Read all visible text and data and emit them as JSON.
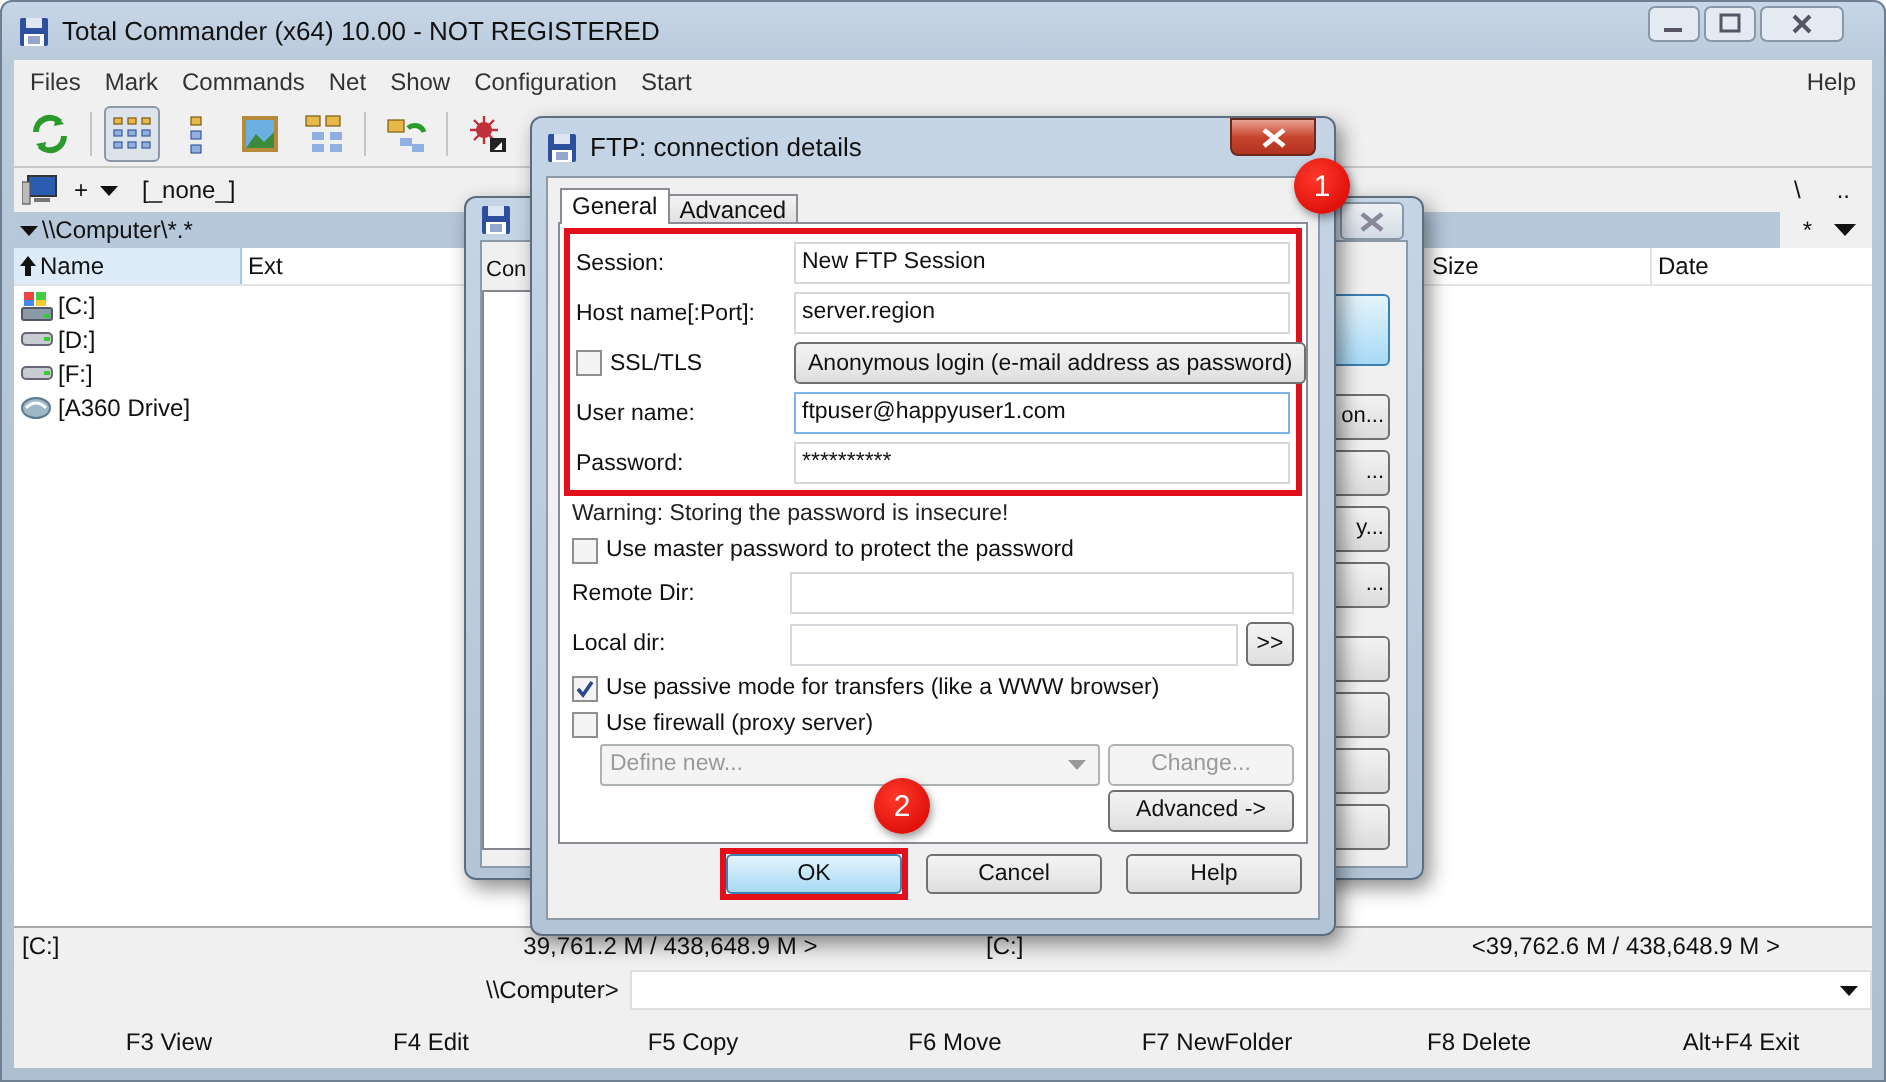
{
  "window": {
    "title": "Total Commander (x64) 10.00 - NOT REGISTERED"
  },
  "menu": [
    "Files",
    "Mark",
    "Commands",
    "Net",
    "Show",
    "Configuration",
    "Start"
  ],
  "menu_right": "Help",
  "toolbar": [
    {
      "kind": "refresh",
      "selected": false
    },
    {
      "kind": "brief",
      "selected": true
    },
    {
      "kind": "detail",
      "selected": false
    },
    {
      "kind": "thumbs",
      "selected": false
    },
    {
      "kind": "tree",
      "selected": false
    },
    {
      "kind": "sync",
      "selected": false
    },
    {
      "kind": "star",
      "selected": false
    }
  ],
  "left_panel": {
    "drive": "+",
    "volume": "[_none_]",
    "path": "\\\\Computer\\*.*",
    "columns": [
      "Name",
      "Ext"
    ],
    "items": [
      {
        "label": "[C:]",
        "kind": "system"
      },
      {
        "label": "[D:]",
        "kind": "drive"
      },
      {
        "label": "[F:]",
        "kind": "drive"
      },
      {
        "label": "[A360 Drive]",
        "kind": "cloud"
      }
    ],
    "status": "[C:]",
    "free": "39,761.2 M / 438,648.9 M >"
  },
  "right_panel": {
    "nav": [
      "\\",
      ".."
    ],
    "filter": "*",
    "columns": [
      "Size",
      "Date"
    ],
    "status": "[C:]",
    "free": "<39,762.6 M / 438,648.9 M >"
  },
  "command_line": {
    "prompt": "\\\\Computer>"
  },
  "function_keys": [
    "F3 View",
    "F4 Edit",
    "F5 Copy",
    "F6 Move",
    "F7 NewFolder",
    "F8 Delete",
    "Alt+F4 Exit"
  ],
  "back_dialog": {
    "tab": "Con",
    "buttons": [
      {
        "default": true
      },
      {
        "label": "on...",
        "default": false
      },
      {
        "label": "...",
        "default": false
      },
      {
        "label": "y...",
        "default": false
      },
      {
        "label": "...",
        "default": false
      },
      {
        "default": false
      },
      {
        "default": false
      },
      {
        "default": false
      },
      {
        "default": false
      }
    ]
  },
  "dialog": {
    "title": "FTP: connection details",
    "tabs": [
      {
        "label": "General",
        "selected": true
      },
      {
        "label": "Advanced",
        "selected": false
      }
    ],
    "groups": [
      {
        "highlighted": true,
        "badge": "1",
        "rows": [
          {
            "kind": "field",
            "label": "Session:",
            "value": "New FTP Session",
            "focused": false
          },
          {
            "kind": "field",
            "label": "Host name[:Port]:",
            "value": "server.region",
            "focused": false
          },
          {
            "kind": "check_button",
            "label": "SSL/TLS",
            "checked": false,
            "button": "Anonymous login (e-mail address as password)"
          },
          {
            "kind": "field",
            "label": "User name:",
            "value": "ftpuser@happyuser1.com",
            "focused": true
          },
          {
            "kind": "field",
            "label": "Password:",
            "value": "**********",
            "focused": false
          }
        ]
      },
      {
        "highlighted": false,
        "rows": [
          {
            "kind": "note",
            "text": "Warning: Storing the password is insecure!"
          },
          {
            "kind": "check",
            "label": "Use master password to protect the password",
            "checked": false
          },
          {
            "kind": "field",
            "label": "Remote Dir:",
            "focused": false
          },
          {
            "kind": "browse",
            "label": "Local dir:",
            "button": ">>"
          },
          {
            "kind": "check",
            "label": "Use passive mode for transfers (like a WWW browser)",
            "checked": true
          },
          {
            "kind": "check",
            "label": "Use firewall (proxy server)",
            "checked": false
          },
          {
            "kind": "combo",
            "value": "Define new...",
            "button": "Change...",
            "disabled": true
          },
          {
            "kind": "right_button",
            "button": "Advanced ->"
          }
        ]
      }
    ],
    "buttons": [
      {
        "label": "OK",
        "default": true,
        "highlighted": true,
        "badge": "2"
      },
      {
        "label": "Cancel",
        "default": false,
        "highlighted": false
      },
      {
        "label": "Help",
        "default": false,
        "highlighted": false
      }
    ]
  }
}
